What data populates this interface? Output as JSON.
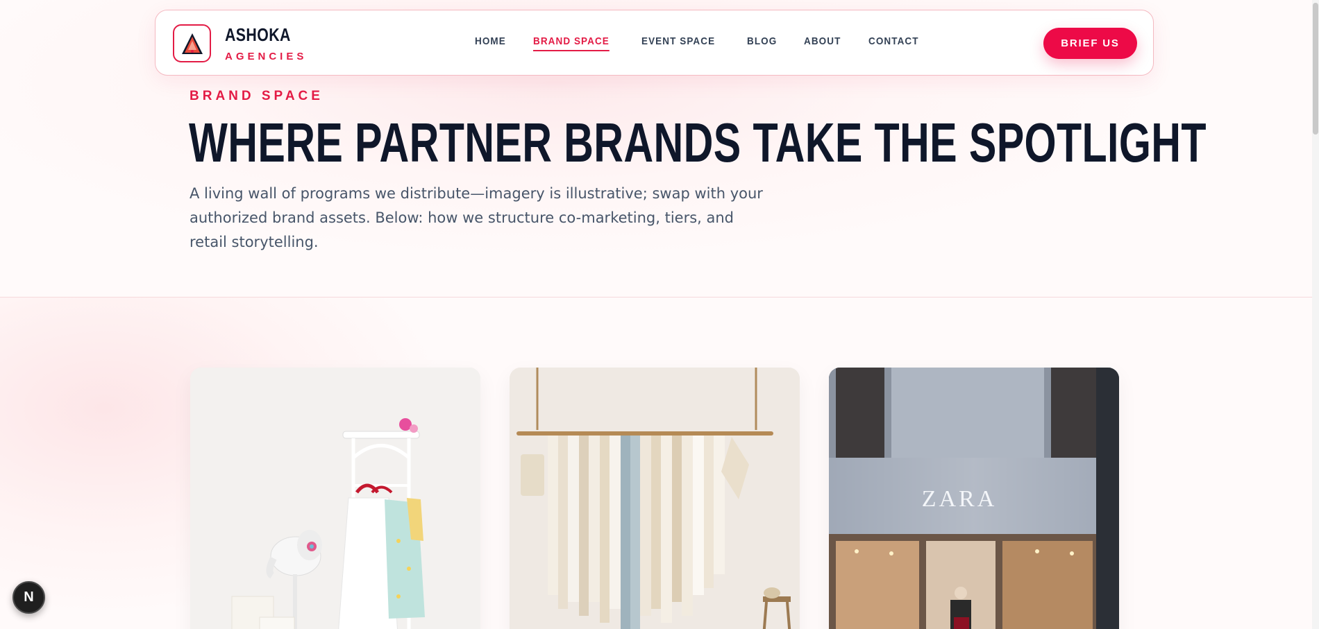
{
  "brand": {
    "name": "ASHOKA",
    "tagline": "AGENCIES"
  },
  "nav": {
    "items": [
      {
        "label": "HOME"
      },
      {
        "label": "BRAND SPACE"
      },
      {
        "label": "EVENT SPACE"
      },
      {
        "label": "BLOG"
      },
      {
        "label": "ABOUT"
      },
      {
        "label": "CONTACT"
      }
    ],
    "active": "BRAND SPACE",
    "cta_label": "BRIEF US"
  },
  "hero": {
    "eyebrow": "BRAND SPACE",
    "title": "WHERE PARTNER BRANDS TAKE THE SPOTLIGHT",
    "lede": "A living wall of programs we distribute—imagery is illustrative; swap with your authorized brand assets. Below: how we structure co-marketing, tiers, and retail storytelling."
  },
  "gallery": {
    "cards": [
      {
        "name": "kids-clothing-rack-image"
      },
      {
        "name": "boutique-clothing-rail-image"
      },
      {
        "name": "zara-storefront-image",
        "sign_text": "ZARA"
      }
    ]
  },
  "dev_badge": {
    "label": "N"
  },
  "colors": {
    "accent": "#e31b45",
    "cta": "#ed0a47",
    "heading": "#0f172a",
    "body": "#475569"
  }
}
